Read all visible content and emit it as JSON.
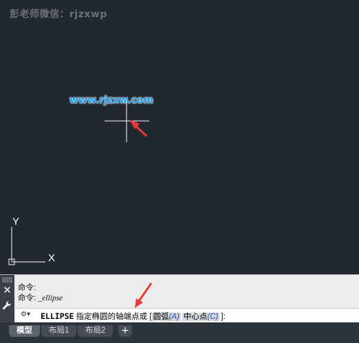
{
  "watermark_top": "彭老师微信：rjzxwp",
  "watermark_center": "www.rjzxw.com",
  "ucs": {
    "y_label": "Y",
    "x_label": "X"
  },
  "command_window": {
    "history": [
      {
        "prefix": "命令:",
        "value": ""
      },
      {
        "prefix": "命令:",
        "value": "_ellipse"
      }
    ],
    "close_glyph": "✕",
    "prompt_icon": "⚙▾",
    "command_name": "ELLIPSE",
    "prompt_text": " 指定椭圆的轴端点或 [",
    "options": [
      {
        "label": "圆弧",
        "key": "(A)"
      },
      {
        "label": "中心点",
        "key": "(C)"
      }
    ],
    "prompt_end": "]:"
  },
  "layout_tabs": [
    {
      "label": "模型",
      "active": true
    },
    {
      "label": "布局1",
      "active": false
    },
    {
      "label": "布局2",
      "active": false
    }
  ],
  "add_tab_glyph": "+",
  "colors": {
    "canvas": "#212830",
    "accent_red": "#e83a3a",
    "crosshair": "#ffffff"
  }
}
